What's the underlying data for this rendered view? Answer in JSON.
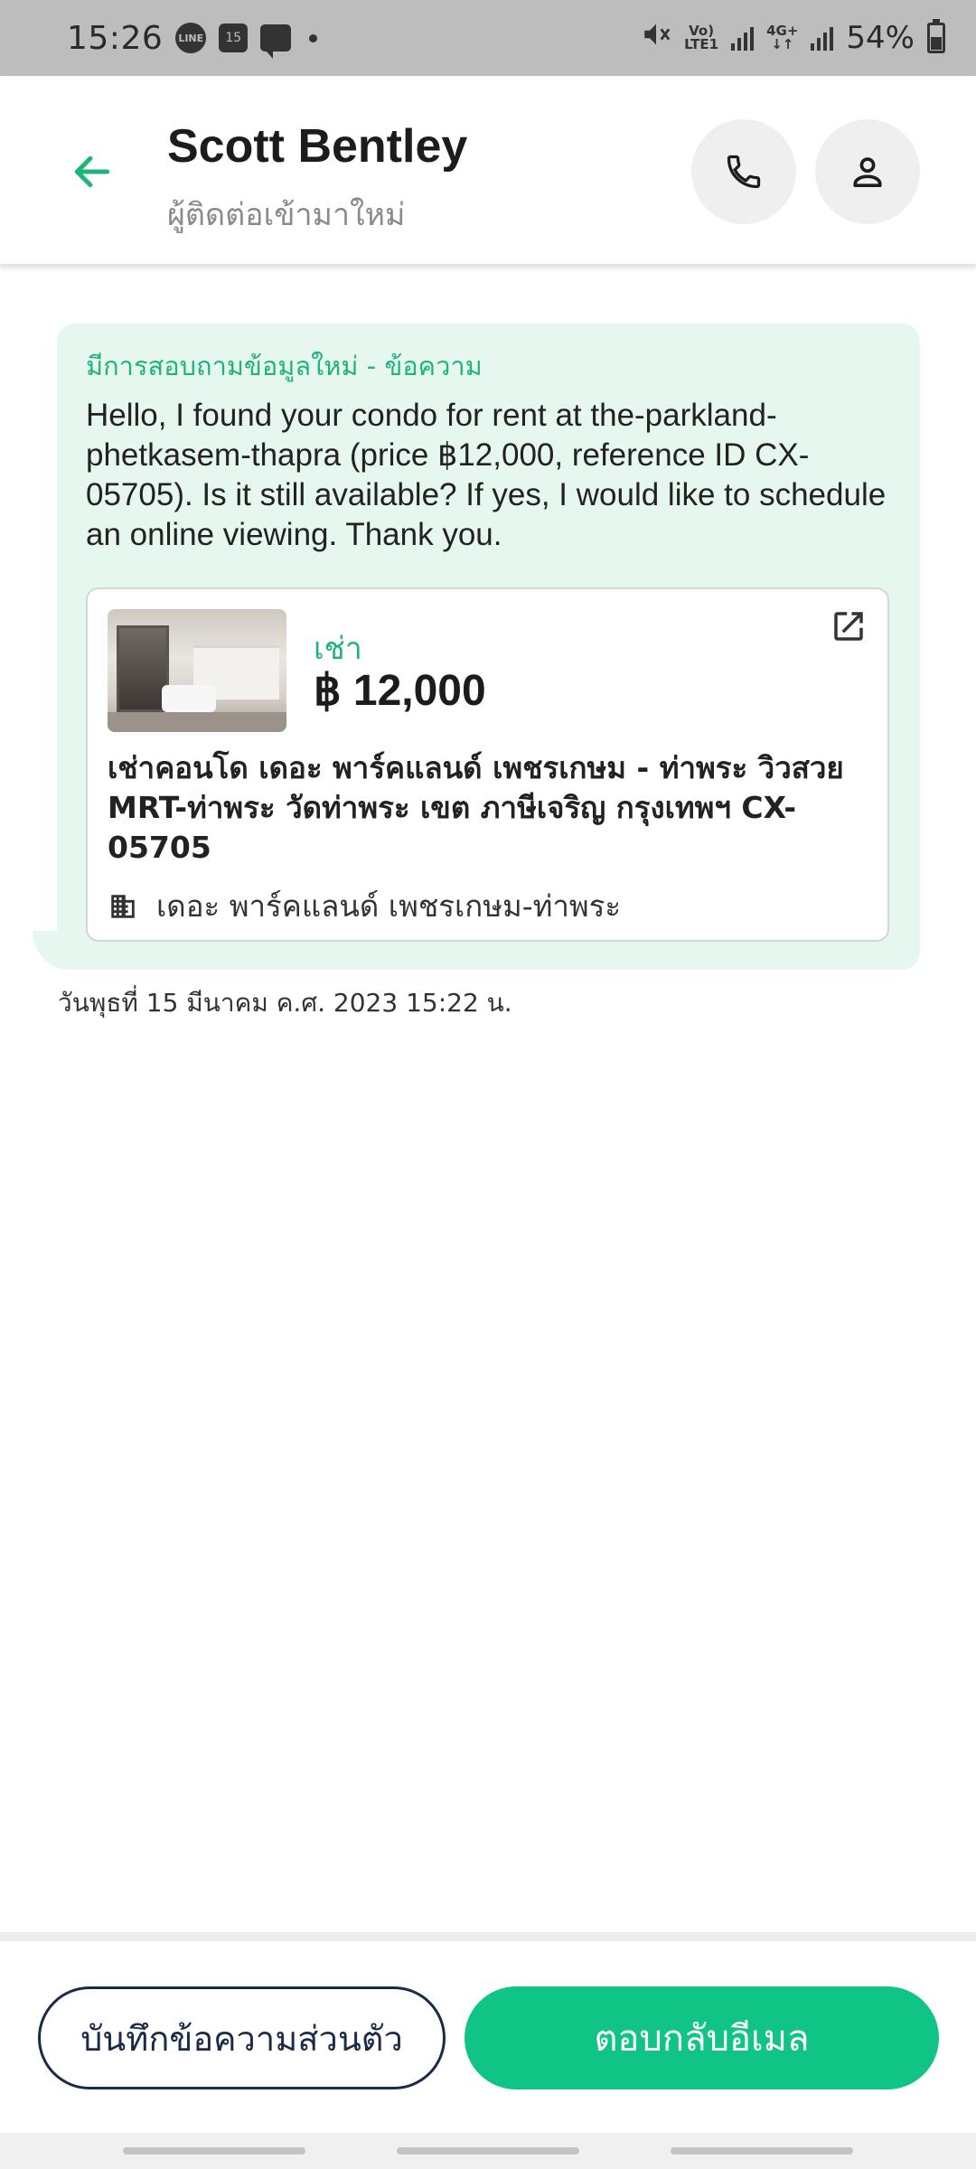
{
  "status_bar": {
    "time": "15:26",
    "line_badge": "LINE",
    "calendar_day": "15",
    "network_top": "Vo)",
    "network_bottom": "LTE1",
    "network2_top": "4G+",
    "network2_bottom": "↓↑",
    "battery": "54%"
  },
  "header": {
    "contact_name": "Scott Bentley",
    "contact_status": "ผู้ติดต่อเข้ามาใหม่"
  },
  "message": {
    "label": "มีการสอบถามข้อมูลใหม่ - ข้อความ",
    "text": "Hello, I found your condo for rent at the-parkland-phetkasem-thapra (price ฿12,000, reference ID CX-05705). Is it still available? If yes, I would like to schedule an online viewing. Thank you.",
    "timestamp": "วันพุธที่ 15 มีนาคม ค.ศ. 2023 15:22 น."
  },
  "listing": {
    "type": "เช่า",
    "price": "฿ 12,000",
    "title": "เช่าคอนโด เดอะ พาร์คแลนด์ เพชรเกษม - ท่าพระ วิวสวย MRT-ท่าพระ วัดท่าพระ เขต ภาษีเจริญ กรุงเทพฯ CX-05705",
    "project": "เดอะ พาร์คแลนด์ เพชรเกษม-ท่าพระ"
  },
  "actions": {
    "note_label": "บันทึกข้อความส่วนตัว",
    "reply_label": "ตอบกลับอีเมล"
  },
  "colors": {
    "accent": "#10c485",
    "bubble_bg": "#e6f7f0",
    "label_green": "#1fb57a",
    "navy": "#1a2a4a"
  }
}
